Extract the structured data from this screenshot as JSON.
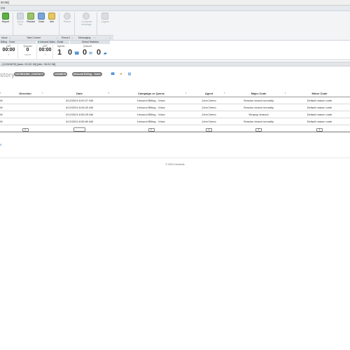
{
  "window": {
    "title": "00:38]"
  },
  "menu": {
    "label": "CS"
  },
  "ribbon": {
    "buttons": [
      {
        "label": "Report",
        "enabled": true,
        "icon": "report-icon"
      },
      {
        "label": "Quick\nSet",
        "enabled": false,
        "icon": "quick-set-icon"
      },
      {
        "label": "Restart",
        "enabled": true,
        "icon": "restart-icon"
      },
      {
        "label": "Code",
        "enabled": true,
        "icon": "code-icon"
      },
      {
        "label": "Info",
        "enabled": true,
        "icon": "info-icon"
      },
      {
        "label": "Pause",
        "enabled": false,
        "icon": "pause-icon"
      },
      {
        "label": "Compose\nmessage",
        "enabled": false,
        "icon": "compose-icon"
      },
      {
        "label": "Logout",
        "enabled": false,
        "icon": "logout-icon"
      }
    ],
    "groups": [
      "Issue",
      "Task Control",
      "Record",
      "Messaging"
    ]
  },
  "stats": {
    "heads": [
      "Billing - Voice",
      "Inbound Sales - Email",
      "Global Statistics"
    ],
    "boxes": [
      {
        "label": "LWT",
        "value": "00:00",
        "sub": "1"
      },
      {
        "label": "Queued",
        "value": "0",
        "sub": "Agents"
      },
      {
        "label": "LWT",
        "value": "00:00",
        "sub": "1"
      },
      {
        "label": "Agents",
        "value": "1",
        "sub": ""
      },
      {
        "label": "Queued",
        "value": "",
        "sub": ""
      }
    ],
    "global_agents": "1",
    "global_queued_voice": "0",
    "global_queued_email": "0"
  },
  "status_line": "- [12345678] [task: 00:02:38] [idle: 00:02:38]",
  "history": {
    "title": "story",
    "tags": [
      "OUTBOUND_CONTACT",
      "12345678",
      "Inbound Billing - Voice"
    ]
  },
  "table": {
    "columns": [
      "Direction",
      "Date",
      "Campaign or Queue",
      "Agent",
      "Major Code",
      "Minor Code"
    ],
    "rows": [
      {
        "first": "W",
        "direction": "",
        "date": "4/12/2024 6:00:27 AM",
        "queue": "Inbound Billing - Voice",
        "agent": "John Demo",
        "major": "Session closed normally",
        "minor": "Default reason code"
      },
      {
        "first": "W",
        "direction": "",
        "date": "4/12/2024 6:06:20 AM",
        "queue": "Inbound Billing - Voice",
        "agent": "John Demo",
        "major": "Session closed normally",
        "minor": "Default reason code"
      },
      {
        "first": "W",
        "direction": "",
        "date": "4/12/2024 6:55:29 AM",
        "queue": "Inbound Billing - Voice",
        "agent": "John Demo",
        "major": "Wrapup timeout",
        "minor": "Default reason code"
      },
      {
        "first": "W",
        "direction": "",
        "date": "4/12/2024 6:55:60 AM",
        "queue": "Inbound Billing - Voice",
        "agent": "John Demo",
        "major": "Session closed normally",
        "minor": "Default reason code"
      }
    ],
    "pager": "4"
  },
  "footer": "© 2024 Geotools"
}
